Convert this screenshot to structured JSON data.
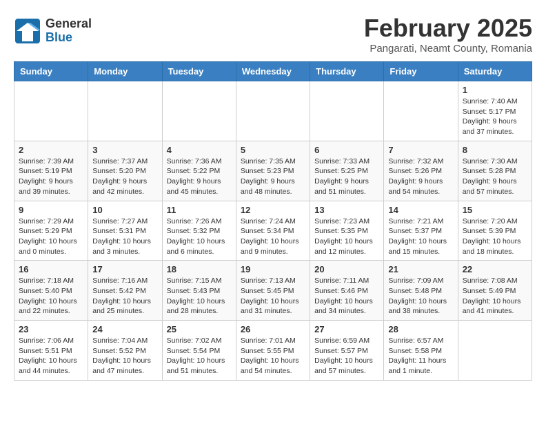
{
  "header": {
    "logo_general": "General",
    "logo_blue": "Blue",
    "month_title": "February 2025",
    "subtitle": "Pangarati, Neamt County, Romania"
  },
  "weekdays": [
    "Sunday",
    "Monday",
    "Tuesday",
    "Wednesday",
    "Thursday",
    "Friday",
    "Saturday"
  ],
  "weeks": [
    [
      {
        "day": null,
        "info": null
      },
      {
        "day": null,
        "info": null
      },
      {
        "day": null,
        "info": null
      },
      {
        "day": null,
        "info": null
      },
      {
        "day": null,
        "info": null
      },
      {
        "day": null,
        "info": null
      },
      {
        "day": "1",
        "info": "Sunrise: 7:40 AM\nSunset: 5:17 PM\nDaylight: 9 hours\nand 37 minutes."
      }
    ],
    [
      {
        "day": "2",
        "info": "Sunrise: 7:39 AM\nSunset: 5:19 PM\nDaylight: 9 hours\nand 39 minutes."
      },
      {
        "day": "3",
        "info": "Sunrise: 7:37 AM\nSunset: 5:20 PM\nDaylight: 9 hours\nand 42 minutes."
      },
      {
        "day": "4",
        "info": "Sunrise: 7:36 AM\nSunset: 5:22 PM\nDaylight: 9 hours\nand 45 minutes."
      },
      {
        "day": "5",
        "info": "Sunrise: 7:35 AM\nSunset: 5:23 PM\nDaylight: 9 hours\nand 48 minutes."
      },
      {
        "day": "6",
        "info": "Sunrise: 7:33 AM\nSunset: 5:25 PM\nDaylight: 9 hours\nand 51 minutes."
      },
      {
        "day": "7",
        "info": "Sunrise: 7:32 AM\nSunset: 5:26 PM\nDaylight: 9 hours\nand 54 minutes."
      },
      {
        "day": "8",
        "info": "Sunrise: 7:30 AM\nSunset: 5:28 PM\nDaylight: 9 hours\nand 57 minutes."
      }
    ],
    [
      {
        "day": "9",
        "info": "Sunrise: 7:29 AM\nSunset: 5:29 PM\nDaylight: 10 hours\nand 0 minutes."
      },
      {
        "day": "10",
        "info": "Sunrise: 7:27 AM\nSunset: 5:31 PM\nDaylight: 10 hours\nand 3 minutes."
      },
      {
        "day": "11",
        "info": "Sunrise: 7:26 AM\nSunset: 5:32 PM\nDaylight: 10 hours\nand 6 minutes."
      },
      {
        "day": "12",
        "info": "Sunrise: 7:24 AM\nSunset: 5:34 PM\nDaylight: 10 hours\nand 9 minutes."
      },
      {
        "day": "13",
        "info": "Sunrise: 7:23 AM\nSunset: 5:35 PM\nDaylight: 10 hours\nand 12 minutes."
      },
      {
        "day": "14",
        "info": "Sunrise: 7:21 AM\nSunset: 5:37 PM\nDaylight: 10 hours\nand 15 minutes."
      },
      {
        "day": "15",
        "info": "Sunrise: 7:20 AM\nSunset: 5:39 PM\nDaylight: 10 hours\nand 18 minutes."
      }
    ],
    [
      {
        "day": "16",
        "info": "Sunrise: 7:18 AM\nSunset: 5:40 PM\nDaylight: 10 hours\nand 22 minutes."
      },
      {
        "day": "17",
        "info": "Sunrise: 7:16 AM\nSunset: 5:42 PM\nDaylight: 10 hours\nand 25 minutes."
      },
      {
        "day": "18",
        "info": "Sunrise: 7:15 AM\nSunset: 5:43 PM\nDaylight: 10 hours\nand 28 minutes."
      },
      {
        "day": "19",
        "info": "Sunrise: 7:13 AM\nSunset: 5:45 PM\nDaylight: 10 hours\nand 31 minutes."
      },
      {
        "day": "20",
        "info": "Sunrise: 7:11 AM\nSunset: 5:46 PM\nDaylight: 10 hours\nand 34 minutes."
      },
      {
        "day": "21",
        "info": "Sunrise: 7:09 AM\nSunset: 5:48 PM\nDaylight: 10 hours\nand 38 minutes."
      },
      {
        "day": "22",
        "info": "Sunrise: 7:08 AM\nSunset: 5:49 PM\nDaylight: 10 hours\nand 41 minutes."
      }
    ],
    [
      {
        "day": "23",
        "info": "Sunrise: 7:06 AM\nSunset: 5:51 PM\nDaylight: 10 hours\nand 44 minutes."
      },
      {
        "day": "24",
        "info": "Sunrise: 7:04 AM\nSunset: 5:52 PM\nDaylight: 10 hours\nand 47 minutes."
      },
      {
        "day": "25",
        "info": "Sunrise: 7:02 AM\nSunset: 5:54 PM\nDaylight: 10 hours\nand 51 minutes."
      },
      {
        "day": "26",
        "info": "Sunrise: 7:01 AM\nSunset: 5:55 PM\nDaylight: 10 hours\nand 54 minutes."
      },
      {
        "day": "27",
        "info": "Sunrise: 6:59 AM\nSunset: 5:57 PM\nDaylight: 10 hours\nand 57 minutes."
      },
      {
        "day": "28",
        "info": "Sunrise: 6:57 AM\nSunset: 5:58 PM\nDaylight: 11 hours\nand 1 minute."
      },
      {
        "day": null,
        "info": null
      }
    ]
  ]
}
